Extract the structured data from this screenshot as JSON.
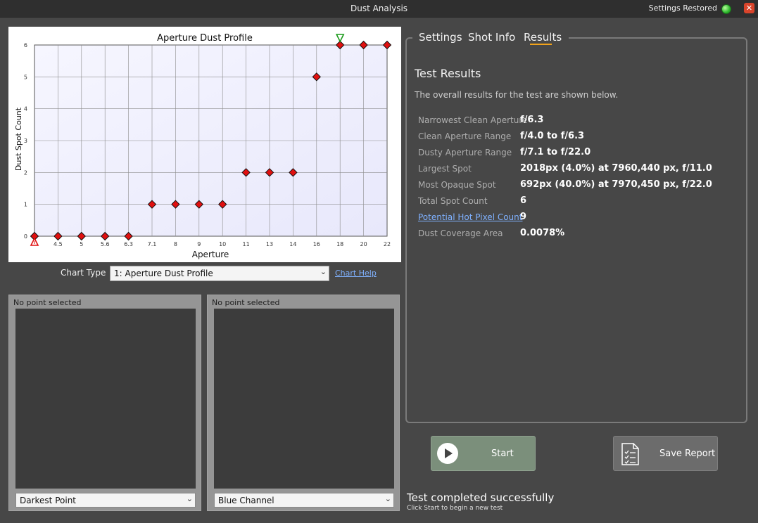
{
  "window": {
    "title": "Dust Analysis",
    "settings_status": "Settings Restored",
    "close_glyph": "✕",
    "colors": {
      "status_led": "#2eb82e",
      "close": "#d9442b"
    }
  },
  "chart_controls": {
    "type_label": "Chart Type",
    "selected_chart": "1: Aperture Dust Profile",
    "help_link": "Chart Help"
  },
  "viewers": [
    {
      "caption": "No point selected",
      "mode": "Darkest Point"
    },
    {
      "caption": "No point selected",
      "mode": "Blue Channel"
    }
  ],
  "tabs": [
    {
      "label": "Settings",
      "active": false
    },
    {
      "label": "Shot Info",
      "active": false
    },
    {
      "label": "Results",
      "active": true
    }
  ],
  "results": {
    "title": "Test Results",
    "description": "The overall results for the test are shown below.",
    "rows": [
      {
        "label": "Narrowest Clean Aperture",
        "value": "f/6.3",
        "link": false
      },
      {
        "label": "Clean Aperture Range",
        "value": "f/4.0 to f/6.3",
        "link": false
      },
      {
        "label": "Dusty Aperture Range",
        "value": "f/7.1 to f/22.0",
        "link": false
      },
      {
        "label": "Largest Spot",
        "value": "2018px (4.0%) at 7960,440 px, f/11.0",
        "link": false
      },
      {
        "label": "Most Opaque Spot",
        "value": "692px (40.0%) at 7970,450 px, f/22.0",
        "link": false
      },
      {
        "label": "Total Spot Count",
        "value": "6",
        "link": false
      },
      {
        "label": "Potential Hot Pixel Count",
        "value": "9",
        "link": true
      },
      {
        "label": "Dust Coverage Area",
        "value": "0.0078%",
        "link": false
      }
    ]
  },
  "buttons": {
    "start": "Start",
    "save_report": "Save Report"
  },
  "status": {
    "main": "Test completed successfully",
    "sub": "Click Start to begin a new test"
  },
  "chart_data": {
    "type": "scatter",
    "title": "Aperture Dust Profile",
    "xlabel": "Aperture",
    "ylabel": "Dust Spot Count",
    "categories": [
      "4",
      "4.5",
      "5",
      "5.6",
      "6.3",
      "7.1",
      "8",
      "9",
      "10",
      "11",
      "13",
      "14",
      "16",
      "18",
      "20",
      "22"
    ],
    "x_tick_labels": [
      "",
      "4.5",
      "5",
      "5.6",
      "6.3",
      "7.1",
      "8",
      "9",
      "10",
      "11",
      "13",
      "14",
      "16",
      "18",
      "20",
      "22"
    ],
    "values": [
      0,
      0,
      0,
      0,
      0,
      1,
      1,
      1,
      1,
      2,
      2,
      2,
      5,
      6,
      6,
      6
    ],
    "ylim": [
      0,
      6
    ],
    "y_ticks": [
      0,
      1,
      2,
      3,
      4,
      5,
      6
    ],
    "grid": true,
    "markers": {
      "largest_spot": "11",
      "most_opaque": "22"
    },
    "annotations": [
      {
        "category": "4",
        "symbol": "triangle-up",
        "color": "#e01010",
        "position": "bottom"
      },
      {
        "category": "18",
        "symbol": "triangle-down",
        "color": "#1a9a1a",
        "position": "top"
      }
    ],
    "colors": {
      "point": "#e01010",
      "plot_bg_start": "#f6f6ff",
      "plot_bg_end": "#e8e8fb"
    }
  }
}
